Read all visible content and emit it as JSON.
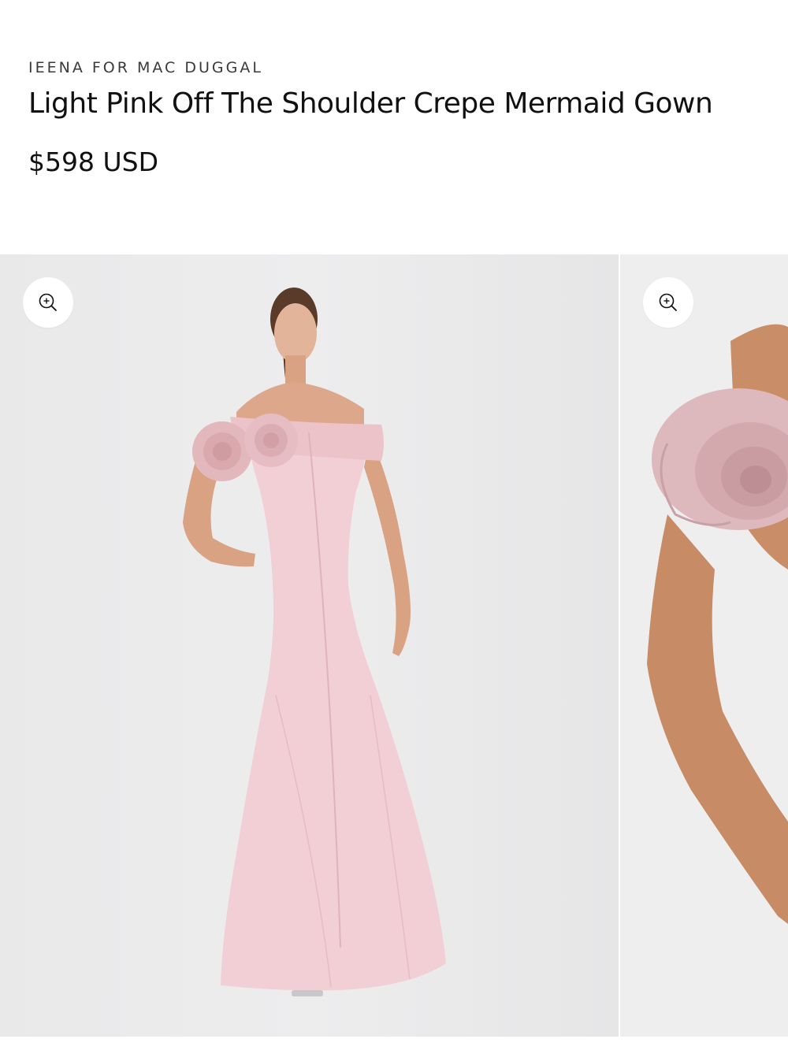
{
  "product": {
    "brand": "IEENA FOR MAC DUGGAL",
    "title": "Light Pink Off The Shoulder Crepe Mermaid Gown",
    "price": "$598 USD"
  },
  "gallery": {
    "images": [
      {
        "name": "gown-front-view",
        "zoom_icon": "zoom-in-icon"
      },
      {
        "name": "rose-sleeve-detail",
        "zoom_icon": "zoom-in-icon"
      }
    ]
  },
  "colors": {
    "gown_pink": "#f1cfd4",
    "rose_pink": "#e3b8bd",
    "skin": "#d9a383",
    "background_gray": "#ececed"
  }
}
